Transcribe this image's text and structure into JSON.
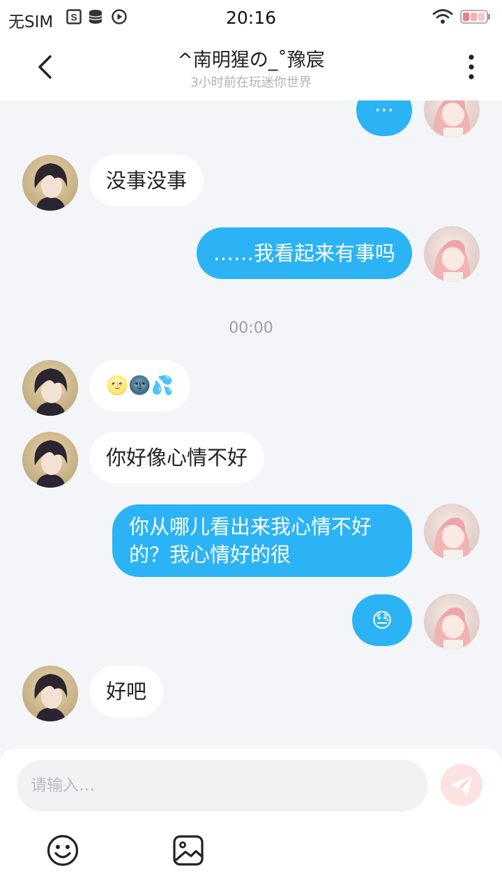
{
  "status_bar": {
    "carrier": "无SIM",
    "time": "20:16",
    "icons": [
      "sim-s-icon",
      "database-icon",
      "play-icon",
      "wifi-icon",
      "battery-icon"
    ]
  },
  "header": {
    "title": "^南明猩の_˚豫宸",
    "subtitle": "3小时前在玩迷你世界",
    "back_icon": "chevron-left-icon",
    "more_icon": "more-vertical-icon"
  },
  "messages": [
    {
      "side": "right",
      "text": "···",
      "partial": true
    },
    {
      "side": "left",
      "text": "没事没事"
    },
    {
      "side": "right",
      "text": "……我看起来有事吗"
    },
    {
      "type": "time",
      "text": "00:00"
    },
    {
      "side": "left",
      "text": "🌝🌚💦"
    },
    {
      "side": "left",
      "text": "你好像心情不好"
    },
    {
      "side": "right",
      "text": "你从哪儿看出来我心情不好的？我心情好的很"
    },
    {
      "side": "right",
      "text": "😓"
    },
    {
      "side": "left",
      "text": "好吧"
    }
  ],
  "composer": {
    "placeholder": "请输入…",
    "send_icon": "paper-plane-icon",
    "emoji_icon": "smiley-icon",
    "image_icon": "image-icon"
  },
  "colors": {
    "accent": "#2bb3f5",
    "background": "#f3f5f8",
    "send_disabled": "#fde2e2"
  }
}
